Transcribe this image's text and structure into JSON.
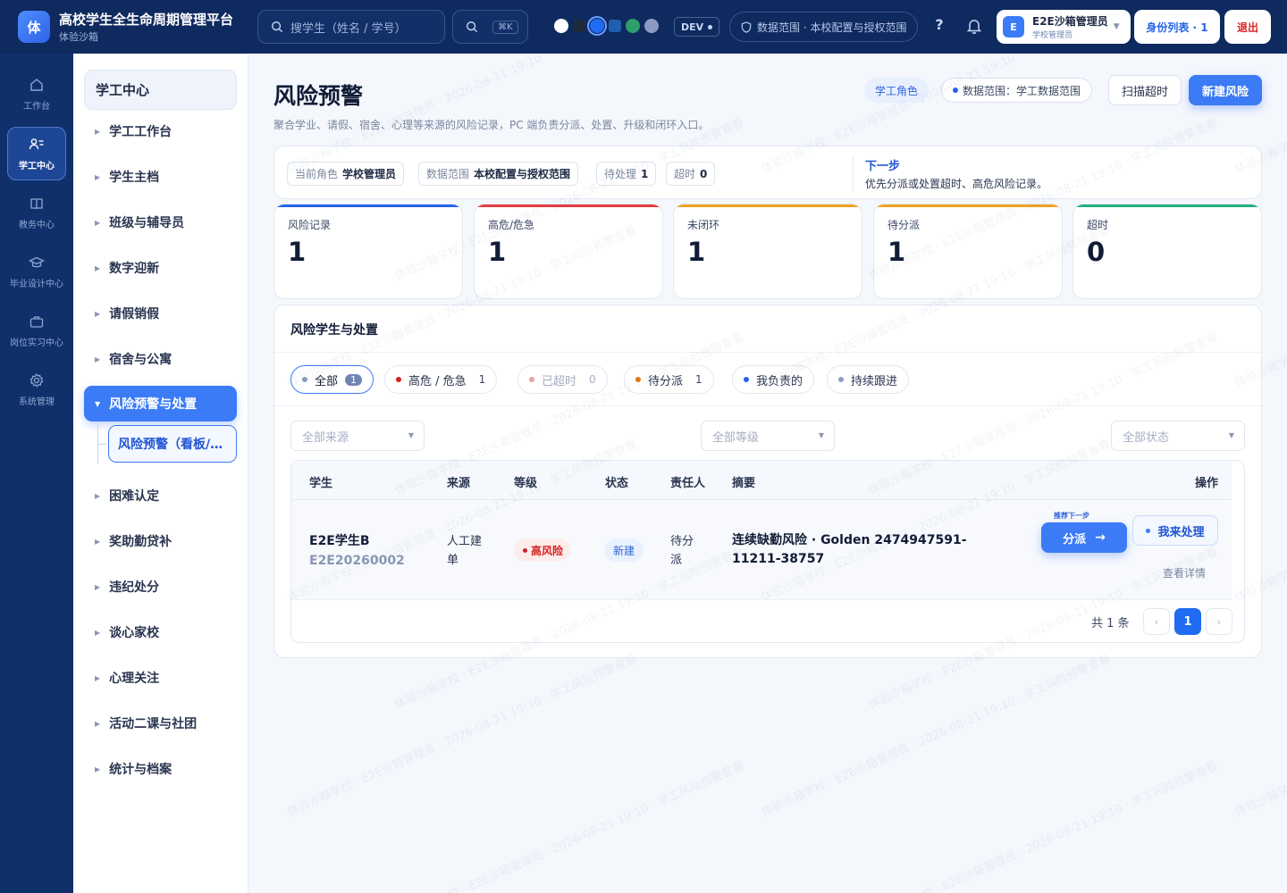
{
  "app": {
    "logo_char": "体",
    "title": "高校学生全生命周期管理平台",
    "subtitle": "体验沙箱"
  },
  "topbar": {
    "search_placeholder": "搜学生（姓名 / 学号）",
    "shortcut": "⌘K",
    "swatches": [
      "#ffffff",
      "#1f2a3c",
      "#1f6bf2",
      "#1f5fae",
      "#2f9e6b",
      "#8d9bc4"
    ],
    "env_badge": "DEV",
    "scope": "数据范围 · 本校配置与授权范围",
    "help": "?",
    "user": {
      "avatar_char": "E",
      "name": "E2E沙箱管理员",
      "role": "学校管理员"
    },
    "identity_button": "身份列表 · 1",
    "logout_button": "退出"
  },
  "rail": [
    {
      "label": "工作台",
      "icon": "home-icon",
      "active": false
    },
    {
      "label": "学工中心",
      "icon": "students-icon",
      "active": true
    },
    {
      "label": "教务中心",
      "icon": "book-icon",
      "active": false
    },
    {
      "label": "毕业设计中心",
      "icon": "graduation-cap-icon",
      "active": false
    },
    {
      "label": "岗位实习中心",
      "icon": "briefcase-icon",
      "active": false
    },
    {
      "label": "系统管理",
      "icon": "gear-icon",
      "active": false
    }
  ],
  "subnav": {
    "title": "学工中心",
    "items": [
      "学工工作台",
      "学生主档",
      "班级与辅导员",
      "数字迎新",
      "请假销假",
      "宿舍与公寓",
      "风险预警与处置",
      "困难认定",
      "奖助勤贷补",
      "违纪处分",
      "谈心家校",
      "心理关注",
      "活动二课与社团",
      "统计与档案"
    ],
    "active_index": 6,
    "active_child": "风险预警（看板/…"
  },
  "page": {
    "title": "风险预警",
    "description": "聚合学业、请假、宿舍、心理等来源的风险记录，PC 端负责分派、处置、升级和闭环入口。",
    "role_tag": "学工角色",
    "scope_tag": "数据范围：学工数据范围",
    "scan_button": "扫描超时",
    "new_button": "新建风险"
  },
  "context": {
    "chips": [
      {
        "label": "当前角色",
        "value": "学校管理员"
      },
      {
        "label": "数据范围",
        "value": "本校配置与授权范围"
      },
      {
        "label": "待处理",
        "value": "1"
      },
      {
        "label": "超时",
        "value": "0"
      }
    ],
    "next_title": "下一步",
    "next_text": "优先分派或处置超时、高危风险记录。"
  },
  "stats": [
    {
      "label": "风险记录",
      "value": "1",
      "color": "#2563eb"
    },
    {
      "label": "高危/危急",
      "value": "1",
      "color": "#e53e3e"
    },
    {
      "label": "未闭环",
      "value": "1",
      "color": "#f0a020"
    },
    {
      "label": "待分派",
      "value": "1",
      "color": "#f0a020"
    },
    {
      "label": "超时",
      "value": "0",
      "color": "#22b07d"
    }
  ],
  "panel": {
    "title": "风险学生与处置",
    "tabs": [
      {
        "label": "全部",
        "count": "1",
        "dot": "#8d9bc4"
      },
      {
        "label": "高危 / 危急",
        "count": "1",
        "dot": "#d42020"
      },
      {
        "label": "已超时",
        "count": "0",
        "dot": "#e8a0a0"
      },
      {
        "label": "待分派",
        "count": "1",
        "dot": "#e07b10"
      },
      {
        "label": "我负责的",
        "count": "",
        "dot": "#2563eb"
      },
      {
        "label": "持续跟进",
        "count": "",
        "dot": "#8d9bc4"
      }
    ],
    "filters": {
      "source": "全部来源",
      "level": "全部等级",
      "status": "全部状态"
    },
    "columns": [
      "学生",
      "来源",
      "等级",
      "状态",
      "责任人",
      "摘要",
      "操作"
    ],
    "rows": [
      {
        "name": "E2E学生B",
        "student_no": "E2E20260002",
        "source": "人工建单",
        "level": "高风险",
        "status": "新建",
        "owner": "待分派",
        "summary": "连续缺勤风险 · Golden 2474947591-11211-38757",
        "recommend_label": "推荐下一步",
        "assign_button": "分派",
        "mine_button": "我来处理",
        "detail_link": "查看详情"
      }
    ],
    "total": "共 1 条",
    "current_page": "1"
  },
  "watermark": "体验沙箱学校 · E2E沙箱管理员 · 2026-08-21 19:10 · 学工风险预警查看"
}
